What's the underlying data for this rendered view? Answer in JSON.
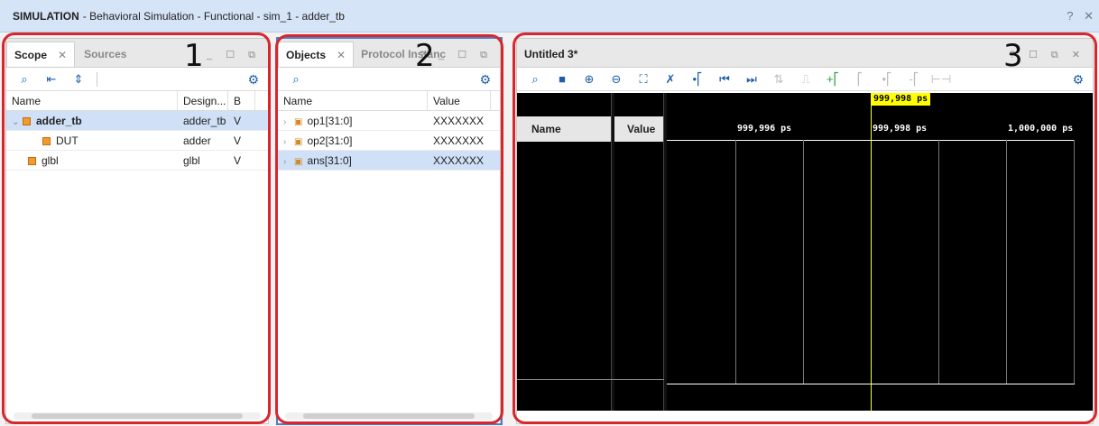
{
  "title": {
    "app": "SIMULATION",
    "rest": "- Behavioral Simulation - Functional - sim_1 - adder_tb",
    "help": "?",
    "close": "✕"
  },
  "scope_panel": {
    "tab_active": "Scope",
    "tab_inactive": "Sources",
    "columns": [
      "Name",
      "Design...",
      "B"
    ],
    "rows": [
      {
        "name": "adder_tb",
        "design": "adder_tb",
        "b": "V"
      },
      {
        "name": "DUT",
        "design": "adder",
        "b": "V"
      },
      {
        "name": "glbl",
        "design": "glbl",
        "b": "V"
      }
    ],
    "number": "1"
  },
  "objects_panel": {
    "tab_active": "Objects",
    "tab_inactive": "Protocol Instanc",
    "columns": [
      "Name",
      "Value"
    ],
    "rows": [
      {
        "name": "op1[31:0]",
        "value": "XXXXXXX"
      },
      {
        "name": "op2[31:0]",
        "value": "XXXXXXX"
      },
      {
        "name": "ans[31:0]",
        "value": "XXXXXXX"
      }
    ],
    "number": "2"
  },
  "wave_panel": {
    "tab": "Untitled 3*",
    "name_header": "Name",
    "value_header": "Value",
    "cursor_label": "999,998 ps",
    "tick_labels": [
      "999,996 ps",
      "999,998 ps",
      "1,000,000 ps"
    ],
    "number": "3"
  },
  "colors": {
    "title_bg": "#d6e4f7",
    "annotation_red": "#d9262c",
    "cursor_yellow": "#ffff00",
    "selection_blue": "#cfe0f7"
  }
}
